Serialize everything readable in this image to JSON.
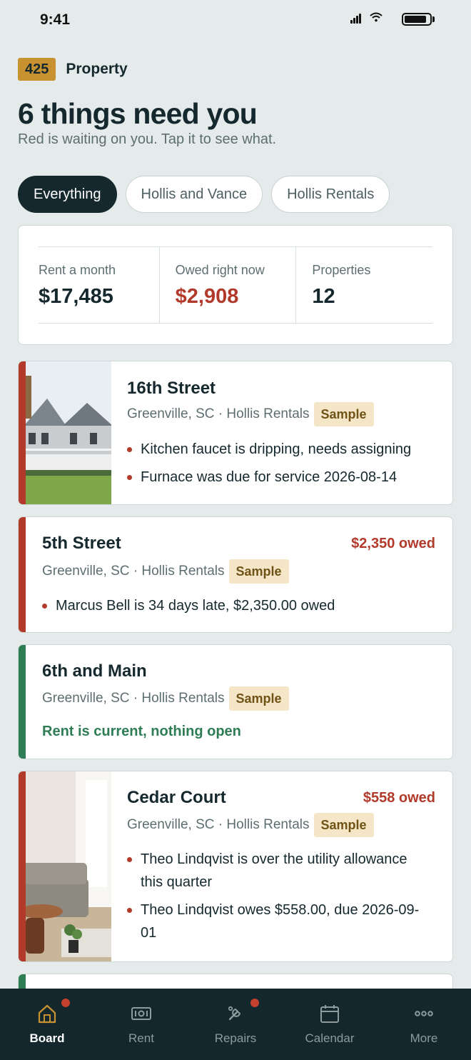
{
  "status": {
    "time": "9:41"
  },
  "brand": {
    "badge": "425",
    "name": "Property"
  },
  "header": {
    "title": "6 things need you",
    "subtitle": "Red is waiting on you. Tap it to see what."
  },
  "filters": [
    {
      "label": "Everything",
      "active": true
    },
    {
      "label": "Hollis and Vance",
      "active": false
    },
    {
      "label": "Hollis Rentals",
      "active": false
    }
  ],
  "summary": {
    "rent": {
      "label": "Rent a month",
      "value": "$17,485"
    },
    "owed": {
      "label": "Owed right now",
      "value": "$2,908"
    },
    "properties": {
      "label": "Properties",
      "value": "12"
    }
  },
  "cards": [
    {
      "title": "16th Street",
      "location": "Greenville, SC · Hollis Rentals",
      "tag": "Sample",
      "status": "red",
      "issues": [
        "Kitchen faucet is dripping, needs assigning",
        "Furnace was due for service 2026-08-14"
      ]
    },
    {
      "title": "5th Street",
      "owed": "$2,350 owed",
      "location": "Greenville, SC · Hollis Rentals",
      "tag": "Sample",
      "status": "red",
      "issues": [
        "Marcus Bell is 34 days late, $2,350.00 owed"
      ]
    },
    {
      "title": "6th and Main",
      "location": "Greenville, SC · Hollis Rentals",
      "tag": "Sample",
      "status": "green",
      "ok_text": "Rent is current, nothing open"
    },
    {
      "title": "Cedar Court",
      "owed": "$558 owed",
      "location": "Greenville, SC · Hollis Rentals",
      "tag": "Sample",
      "status": "red",
      "issues": [
        "Theo Lindqvist is over the utility allowance this quarter",
        "Theo Lindqvist owes $558.00, due 2026-09-01"
      ]
    }
  ],
  "tabs": [
    {
      "label": "Board",
      "icon": "home-icon",
      "active": true,
      "badge": true
    },
    {
      "label": "Rent",
      "icon": "cash-icon",
      "active": false,
      "badge": false
    },
    {
      "label": "Repairs",
      "icon": "wrench-icon",
      "active": false,
      "badge": true
    },
    {
      "label": "Calendar",
      "icon": "calendar-icon",
      "active": false,
      "badge": false
    },
    {
      "label": "More",
      "icon": "more-icon",
      "active": false,
      "badge": false
    }
  ],
  "colors": {
    "accent": "#c99231",
    "alert": "#b23a2a",
    "ok": "#2f7d55",
    "dark": "#15282d"
  }
}
